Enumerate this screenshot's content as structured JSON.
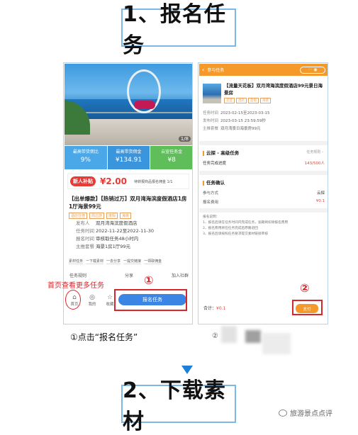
{
  "step1_title": "1、报名任务",
  "step2_title": "2、下载素材",
  "phone1": {
    "hero_badge": "1/8",
    "stats": [
      {
        "label": "最高带货佣比",
        "value": "9%",
        "color": "#4aa8e8"
      },
      {
        "label": "最高带货佣金",
        "value": "¥134.91",
        "color": "#3b95dd"
      },
      {
        "label": "云宣任务金",
        "value": "¥8",
        "color": "#5fbd5a"
      }
    ],
    "promo_tag": "新人补贴",
    "promo_amount": "¥2.00",
    "promo_note": "待转报商品报名佣金 1/1",
    "title": "【出单爆款】【热销过万】双月湾海滨度假酒店1房1厅海景99元",
    "tags": [
      "酒店住宿",
      "周边游",
      "度假",
      "海景"
    ],
    "info": [
      {
        "k": "发布人",
        "v": "双月湾海滨度假酒店"
      },
      {
        "k": "任务时间",
        "v": "2022-11-22至2022-11-30"
      },
      {
        "k": "报名时间",
        "v": "审核取任务48小时内"
      },
      {
        "k": "主推套餐",
        "v": "海景1房1厅99元"
      }
    ],
    "share_items": [
      "素材任务",
      "一下载素材",
      "一去分享",
      "一提交链接",
      "一领取佣金"
    ],
    "actions": [
      "任务规则",
      "分享",
      "加入社群"
    ],
    "tabs": [
      {
        "icon": "⌂",
        "label": "首页"
      },
      {
        "icon": "◎",
        "label": "我的"
      },
      {
        "icon": "☆",
        "label": "收藏"
      }
    ],
    "signup_button": "报名任务"
  },
  "phone2": {
    "header_title": "参与任务",
    "title": "【流量天花板】双月湾海滨度假酒店99元景日海景房",
    "tags": [
      "云宣",
      "酒店",
      "度假",
      "海景"
    ],
    "info": [
      {
        "k": "任务时间",
        "v": "2023-02-15至2023-03-15"
      },
      {
        "k": "发布时间",
        "v": "2023-03-15 23:59:59秒"
      },
      {
        "k": "主推套餐",
        "v": "双月湾景日海景房99元"
      }
    ],
    "section1_title": "云探 - 高级任务",
    "section1_right": "任务规则 ›",
    "progress_label": "任务完成进度",
    "progress_value": "143/500人",
    "section2_title": "任务确认",
    "kv": [
      {
        "k": "参与方式",
        "v": "云探"
      },
      {
        "k": "报名费用",
        "v": "¥0.1"
      }
    ],
    "notes": [
      "报名说明：",
      "1、报名后请在任务时间内完成任务，逾期将扣除报名费用",
      "2、报名费用将在任务完成后原路退回",
      "3、报名后请按照任务要求提交素材链接审核"
    ],
    "total_label": "合计：",
    "total_value": "¥0.1",
    "pay_button": "支付"
  },
  "annotations": {
    "home_hint": "首页查看更多任务",
    "num1": "①",
    "num2": "②",
    "caption1": "①点击“报名任务”",
    "caption2": "②"
  },
  "watermark": "旅游景点点评",
  "colors": {
    "accent_red": "#d8262b",
    "blue": "#3b86e5",
    "orange": "#f59a2a",
    "frame": "#7cb8e6"
  }
}
